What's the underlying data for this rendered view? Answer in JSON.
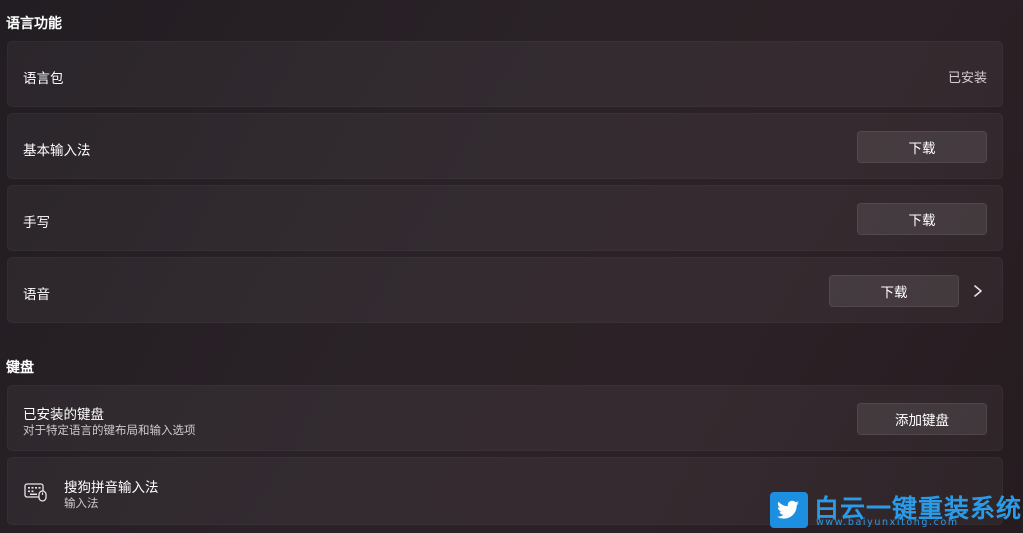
{
  "sections": {
    "language_features": {
      "title": "语言功能"
    },
    "keyboard": {
      "title": "键盘"
    }
  },
  "language_pack": {
    "label": "语言包",
    "status": "已安装"
  },
  "basic_input": {
    "label": "基本输入法",
    "button": "下载"
  },
  "handwriting": {
    "label": "手写",
    "button": "下载"
  },
  "speech": {
    "label": "语音",
    "button": "下载"
  },
  "installed_keyboards": {
    "label": "已安装的键盘",
    "description": "对于特定语言的键布局和输入选项",
    "button": "添加键盘"
  },
  "sogou": {
    "name": "搜狗拼音输入法",
    "type": "输入法"
  },
  "watermark": {
    "title": "白云一键重装系统",
    "url": "www.baiyunxitong.com"
  },
  "icons": {
    "chevron": "chevron-right-icon",
    "keyboard": "keyboard-icon",
    "bird": "twitter-bird-icon"
  },
  "colors": {
    "background": "#271f24",
    "card": "#312a2f",
    "button": "#3b3338",
    "watermark": "#2b9be8"
  }
}
